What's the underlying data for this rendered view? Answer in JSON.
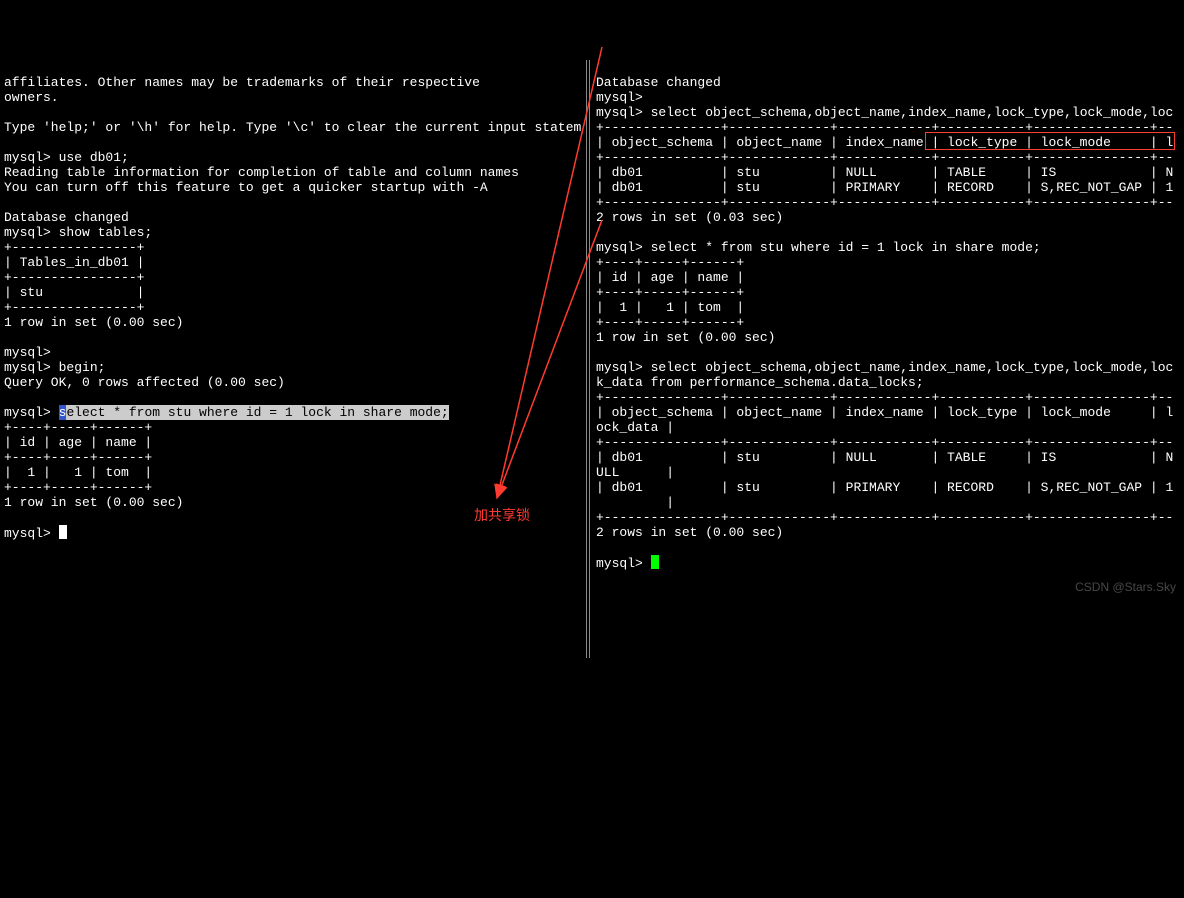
{
  "left": {
    "line1": "affiliates. Other names may be trademarks of their respective",
    "line2": "owners.",
    "line3": "Type 'help;' or '\\h' for help. Type '\\c' to clear the current input statem",
    "prompt": "mysql>",
    "use_cmd": "use db01;",
    "reading1": "Reading table information for completion of table and column names",
    "reading2": "You can turn off this feature to get a quicker startup with -A",
    "db_changed": "Database changed",
    "show_cmd": "show tables;",
    "tables_div": "+----------------+",
    "tables_hdr": "| Tables_in_db01 |",
    "tables_row": "| stu            |",
    "one_row": "1 row in set (0.00 sec)",
    "begin_cmd": "begin;",
    "begin_res": "Query OK, 0 rows affected (0.00 sec)",
    "sel_cmd": "select * from stu where id = 1 lock in share mode;",
    "stu_div": "+----+-----+------+",
    "stu_hdr": "| id | age | name |",
    "stu_row": "|  1 |   1 | tom  |",
    "annotation": "加共享锁"
  },
  "right": {
    "db_changed": "Database changed",
    "prompt": "mysql>",
    "sel_locks1": "select object_schema,object_name,index_name,lock_type,lock_mode,loc",
    "table1_div": "+---------------+-------------+------------+-----------+---------------+--",
    "table1_hdr": "| object_schema | object_name | index_name | lock_type | lock_mode     | l",
    "table1_r1": "| db01          | stu         | NULL       | TABLE     | IS            | N",
    "table1_r2": "| db01          | stu         | PRIMARY    | RECORD    | S,REC_NOT_GAP | 1",
    "two_rows003": "2 rows in set (0.03 sec)",
    "sel_stu": "select * from stu where id = 1 lock in share mode;",
    "stu_div": "+----+-----+------+",
    "stu_hdr": "| id | age | name |",
    "stu_row": "|  1 |   1 | tom  |",
    "one_row": "1 row in set (0.00 sec)",
    "sel_locks2a": "select object_schema,object_name,index_name,lock_type,lock_mode,loc",
    "sel_locks2b": "k_data from performance_schema.data_locks;",
    "table2_div": "+---------------+-------------+------------+-----------+---------------+--",
    "table2_hdr1": "| object_schema | object_name | index_name | lock_type | lock_mode     | l",
    "table2_hdr2": "ock_data |",
    "table2_r1a": "| db01          | stu         | NULL       | TABLE     | IS            | N",
    "table2_r1b": "ULL      |",
    "table2_r2a": "| db01          | stu         | PRIMARY    | RECORD    | S,REC_NOT_GAP | 1",
    "table2_r2b": "         |",
    "two_rows000": "2 rows in set (0.00 sec)"
  },
  "watermark": "CSDN @Stars.Sky",
  "chart_data": {
    "type": "table",
    "tables": [
      {
        "title": "show tables (db01)",
        "columns": [
          "Tables_in_db01"
        ],
        "rows": [
          [
            "stu"
          ]
        ]
      },
      {
        "title": "select * from stu where id=1 lock in share mode",
        "columns": [
          "id",
          "age",
          "name"
        ],
        "rows": [
          [
            1,
            1,
            "tom"
          ]
        ]
      },
      {
        "title": "performance_schema.data_locks (first query)",
        "columns": [
          "object_schema",
          "object_name",
          "index_name",
          "lock_type",
          "lock_mode",
          "lock_data"
        ],
        "rows": [
          [
            "db01",
            "stu",
            null,
            "TABLE",
            "IS",
            null
          ],
          [
            "db01",
            "stu",
            "PRIMARY",
            "RECORD",
            "S,REC_NOT_GAP",
            1
          ]
        ]
      },
      {
        "title": "performance_schema.data_locks (second query)",
        "columns": [
          "object_schema",
          "object_name",
          "index_name",
          "lock_type",
          "lock_mode",
          "lock_data"
        ],
        "rows": [
          [
            "db01",
            "stu",
            null,
            "TABLE",
            "IS",
            null
          ],
          [
            "db01",
            "stu",
            "PRIMARY",
            "RECORD",
            "S,REC_NOT_GAP",
            1
          ]
        ]
      }
    ]
  }
}
